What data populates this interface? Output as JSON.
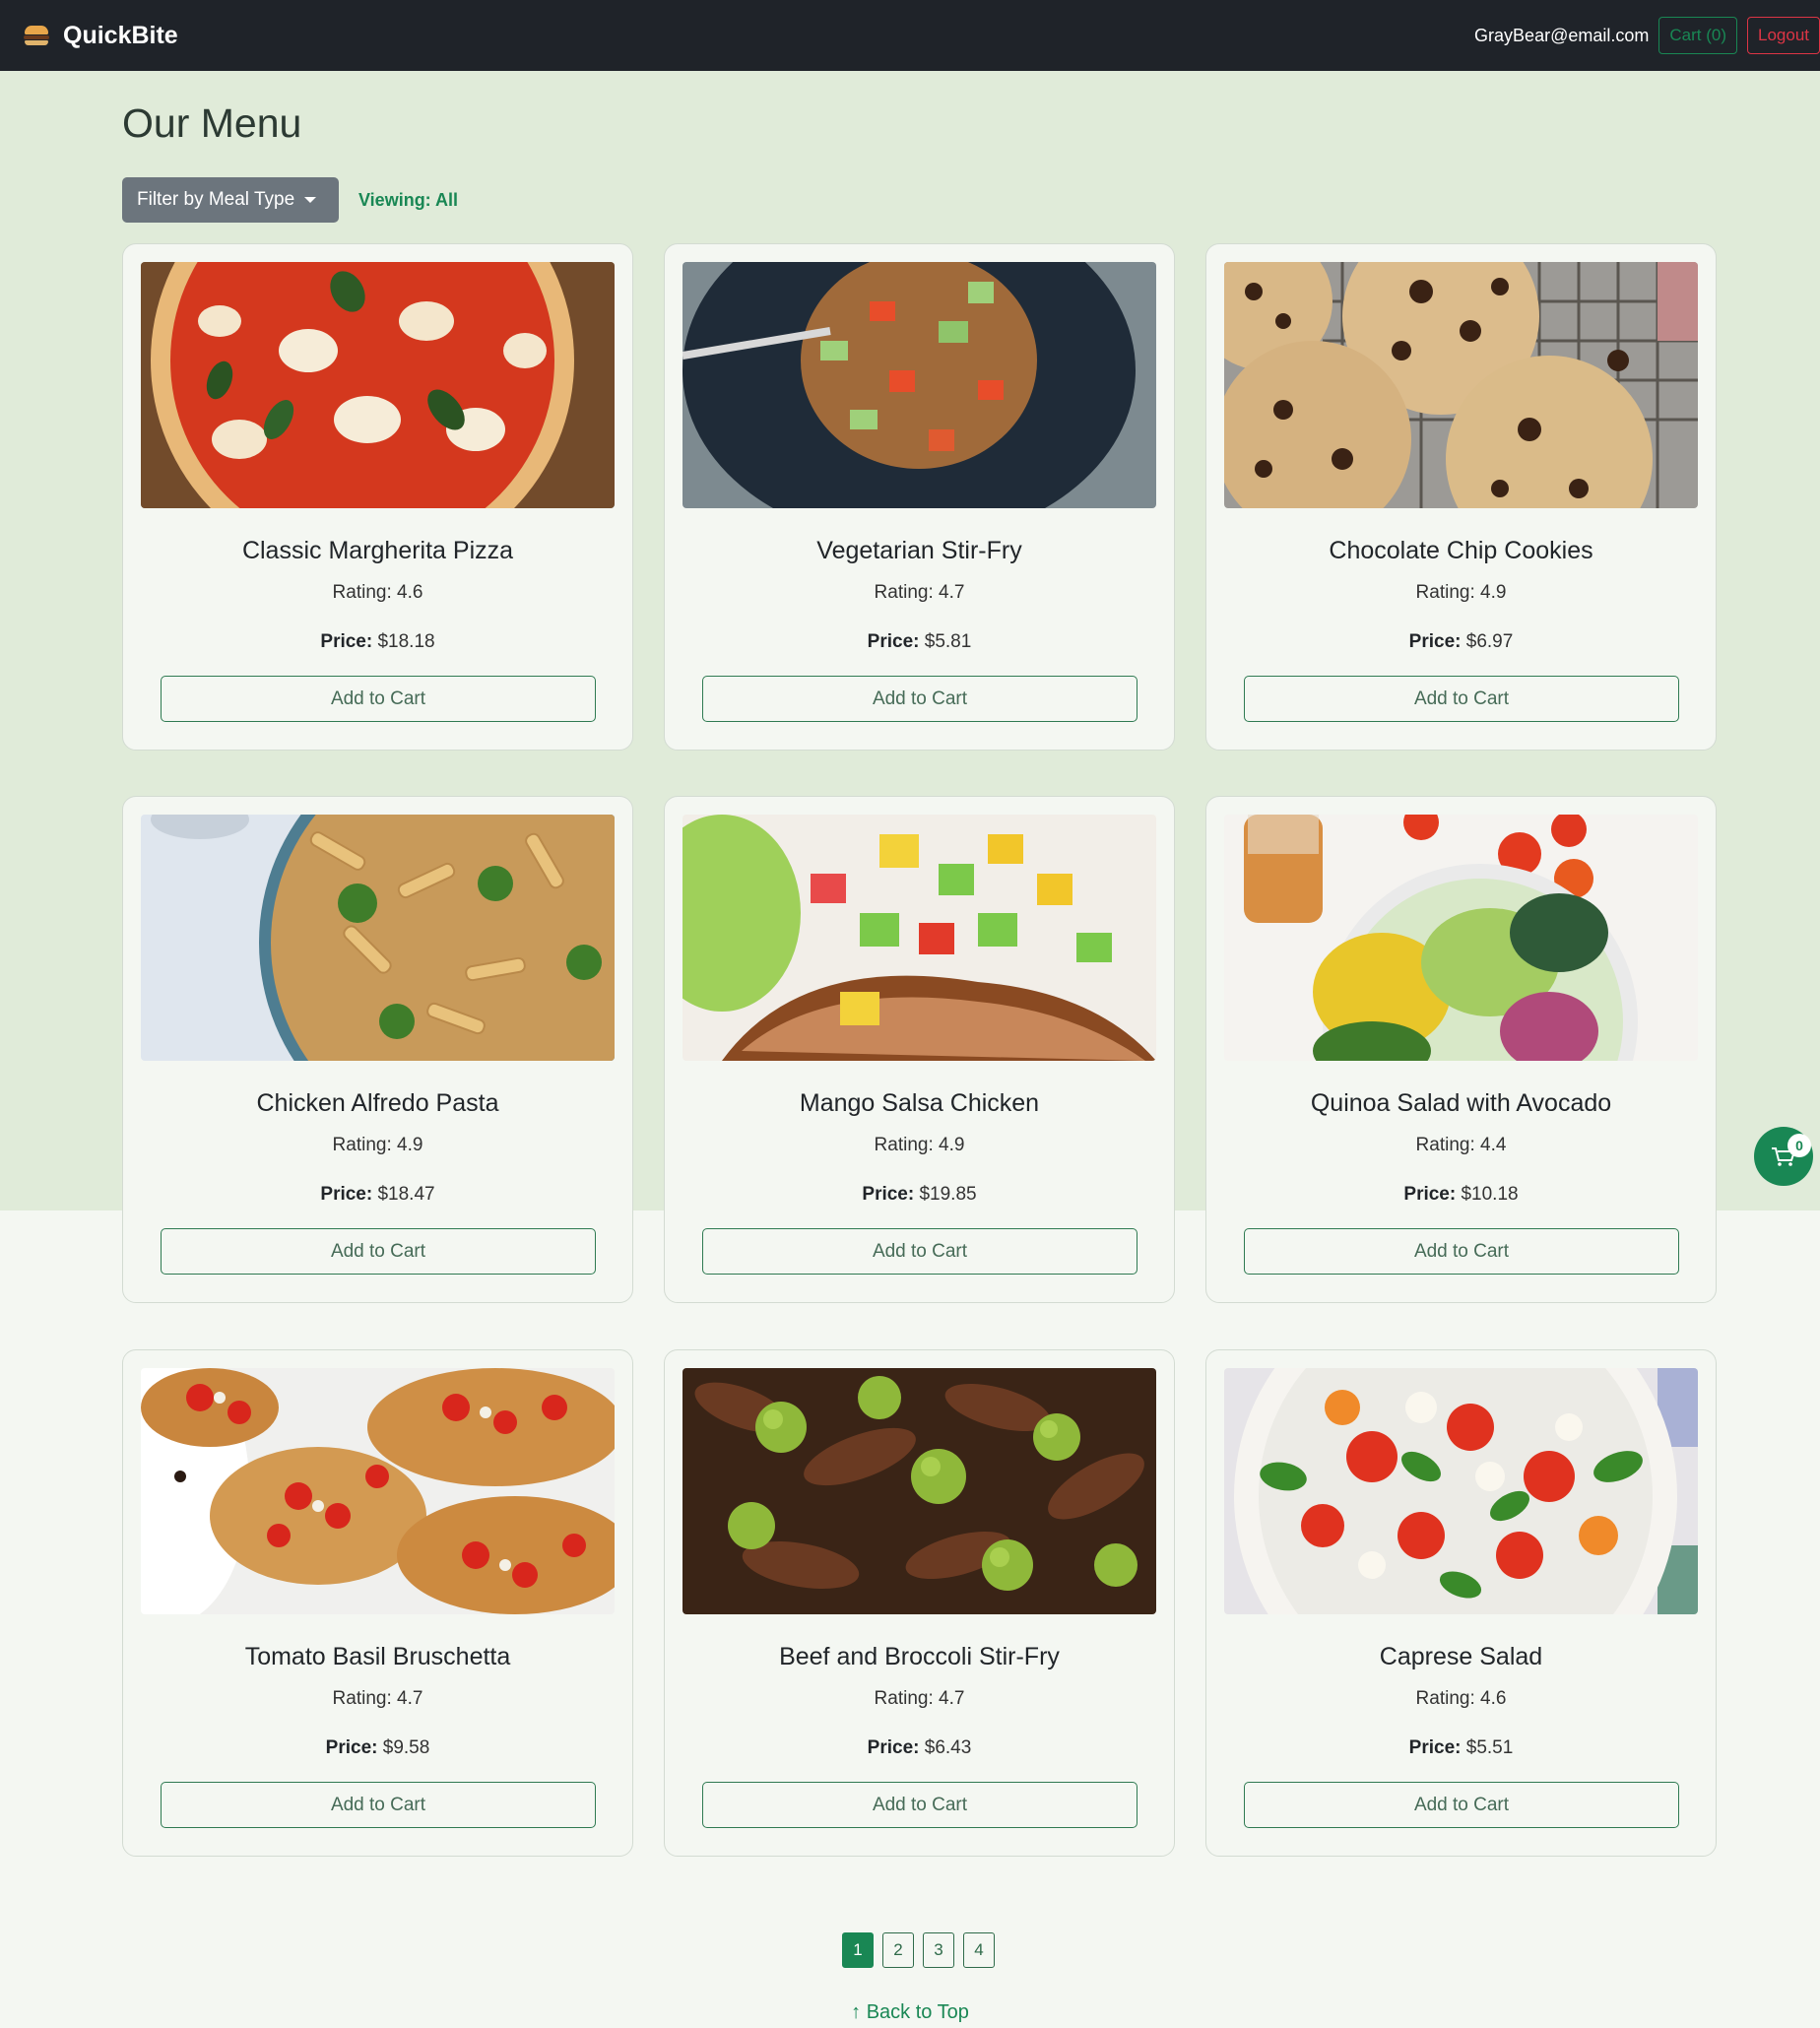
{
  "navbar": {
    "brand_name": "QuickBite",
    "user_email": "GrayBear@email.com",
    "cart_label": "Cart (0)",
    "logout_label": "Logout"
  },
  "page": {
    "title": "Our Menu",
    "filter_label": "Filter by Meal Type",
    "viewing_label": "Viewing: All"
  },
  "price_label": "Price:",
  "add_to_cart_label": "Add to Cart",
  "menu_items": [
    {
      "name": "Classic Margherita Pizza",
      "rating": "Rating: 4.6",
      "price": "$18.18"
    },
    {
      "name": "Vegetarian Stir-Fry",
      "rating": "Rating: 4.7",
      "price": "$5.81"
    },
    {
      "name": "Chocolate Chip Cookies",
      "rating": "Rating: 4.9",
      "price": "$6.97"
    },
    {
      "name": "Chicken Alfredo Pasta",
      "rating": "Rating: 4.9",
      "price": "$18.47"
    },
    {
      "name": "Mango Salsa Chicken",
      "rating": "Rating: 4.9",
      "price": "$19.85"
    },
    {
      "name": "Quinoa Salad with Avocado",
      "rating": "Rating: 4.4",
      "price": "$10.18"
    },
    {
      "name": "Tomato Basil Bruschetta",
      "rating": "Rating: 4.7",
      "price": "$9.58"
    },
    {
      "name": "Beef and Broccoli Stir-Fry",
      "rating": "Rating: 4.7",
      "price": "$6.43"
    },
    {
      "name": "Caprese Salad",
      "rating": "Rating: 4.6",
      "price": "$5.51"
    }
  ],
  "pagination": {
    "pages": [
      "1",
      "2",
      "3",
      "4"
    ],
    "current": "1"
  },
  "back_to_top_label": "↑ Back to Top",
  "floating_cart": {
    "icon": "shopping-cart-icon",
    "count": "0"
  },
  "colors": {
    "navbar_bg": "#1f2329",
    "accent_green": "#198754",
    "danger_red": "#dc3545",
    "hero_bg": "#e0ebd9",
    "page_bg": "#f4f7f2"
  }
}
